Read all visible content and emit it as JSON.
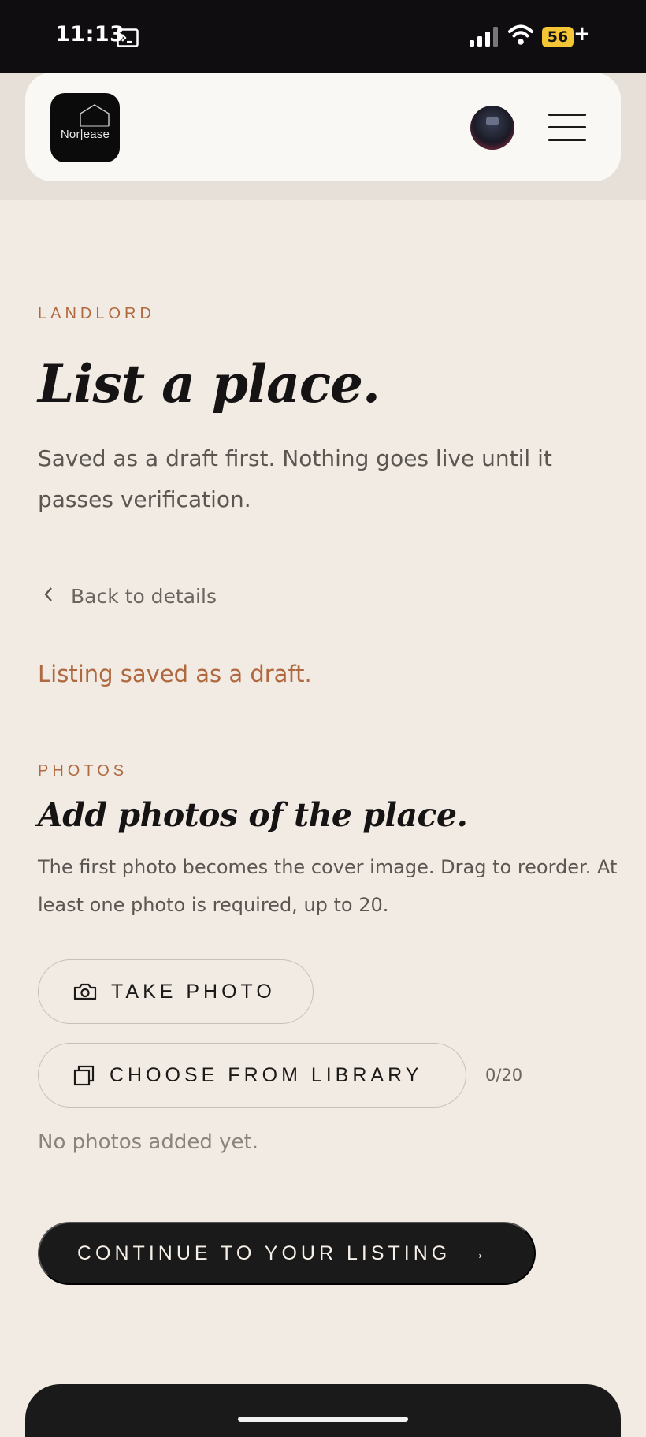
{
  "status_bar": {
    "time": "11:13",
    "battery": "56",
    "battery_suffix": "+",
    "icons": [
      "terminal-icon",
      "signal-icon",
      "wifi-icon",
      "battery-icon"
    ]
  },
  "header": {
    "logo_text": "Nor|ease",
    "icons": [
      "avatar",
      "menu-icon"
    ]
  },
  "main": {
    "eyebrow": "LANDLORD",
    "title": "List a place.",
    "intro": "Saved as a draft first. Nothing goes live until it passes verification.",
    "back_link": "Back to details",
    "saved_notice": "Listing saved as a draft."
  },
  "photos": {
    "eyebrow": "PHOTOS",
    "title": "Add photos of the place.",
    "description": "The first photo becomes the cover image. Drag to reorder. At least one photo is required, up to 20.",
    "take_photo_label": "TAKE PHOTO",
    "choose_library_label": "CHOOSE FROM LIBRARY",
    "count": "0/20",
    "empty_text": "No photos added yet.",
    "continue_label": "CONTINUE TO YOUR LISTING",
    "continue_arrow": "→"
  },
  "colors": {
    "accent": "#b0683f",
    "background": "#f2ebe3",
    "dark": "#1b1a1a"
  }
}
